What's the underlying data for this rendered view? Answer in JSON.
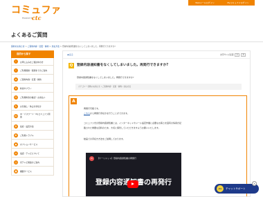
{
  "header": {
    "logo_text": "コミュファ",
    "logo_powered": "Powered by",
    "logo_ctc": "ctc",
    "btn_home": "Webメールログイン",
    "btn_mypage": "Myコミュファログイン"
  },
  "page_title": "よくあるご質問",
  "breadcrumb": {
    "items": [
      "契約のお客さま",
      "ご契約内容・変更・解約",
      "支払方法"
    ],
    "current": "登録内容通知書をなくしてしまいました。再発行できますか?"
  },
  "sidebar": {
    "header": "目的から探す",
    "items": [
      {
        "icon": "!",
        "label": "お申し込みをご検討中の方"
      },
      {
        "icon": "!",
        "label": "ご利用開始・開通までのご案内"
      },
      {
        "icon": "≡",
        "label": "ご契約内容・変更・解約"
      },
      {
        "icon": "¥",
        "label": "料金やプラン"
      },
      {
        "icon": "✉",
        "label": "ご利用料金の確認・お支払い"
      },
      {
        "icon": "↻",
        "label": "お引越し・休止の手続き"
      },
      {
        "icon": "ID",
        "label": "ID・パスワード・Myコミュファ関連"
      },
      {
        "icon": "⚙",
        "label": "接続・設定方法"
      },
      {
        "icon": "✚",
        "label": "ご利用トラブル"
      },
      {
        "icon": "◆",
        "label": "オプションサービス"
      },
      {
        "icon": "☏",
        "label": "電話・テレビについて"
      },
      {
        "icon": "◎",
        "label": "光テレビ関連のご案内"
      },
      {
        "icon": "▣",
        "label": "機器サービス"
      }
    ]
  },
  "main": {
    "back_label": "戻る",
    "font_size_label": "文字サイズ変更",
    "font_size_small": "小",
    "font_size_large": "大",
    "question_badge": "Q",
    "question_title": "登録内容通知書をなくしてしまいました。再発行できますか?",
    "question_body": "登録内容通知書をなくしてしまいました。再発行できますか?",
    "category_path": "カテゴリー:契約のお客さま / ご契約内容・変更・解約 / 支払方法",
    "answer_badge": "A",
    "answer_line1": "再発行可能です。",
    "answer_link": "こちら",
    "answer_line2": "から再発行手続きを行うことができます。",
    "answer_line3": "コミュファ光の登録内容通知書とは、インターネットやメール設定作業に必要なお客さま固有の情報が記",
    "answer_line4": "載された重要な資料のため、大切に保管していただきますようお願いいたします。",
    "answer_line5": "動画での手続き方法をご説明しております。"
  },
  "video": {
    "avatar_text": "ctc",
    "title": "【ケーリドット】登録内容通知書の再発行",
    "heading": "登録内容通知書の再発行"
  },
  "chat": {
    "label": "チャットサポート",
    "icon_text": "ctc",
    "close_label": "×"
  }
}
